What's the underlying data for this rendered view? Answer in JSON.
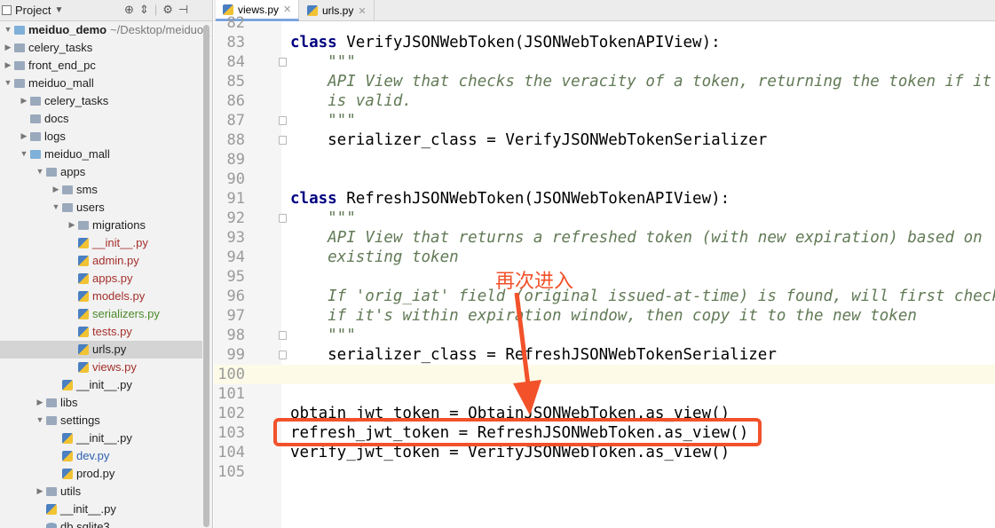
{
  "project_panel": {
    "title": "Project",
    "tree": [
      {
        "label": "meiduo_demo",
        "suffix": "~/Desktop/meiduo_",
        "indent": 0,
        "type": "folder-blue",
        "arrow": "down",
        "style": "bold"
      },
      {
        "label": "celery_tasks",
        "indent": 0,
        "type": "folder",
        "arrow": "right"
      },
      {
        "label": "front_end_pc",
        "indent": 0,
        "type": "folder",
        "arrow": "right"
      },
      {
        "label": "meiduo_mall",
        "indent": 0,
        "type": "folder",
        "arrow": "down"
      },
      {
        "label": "celery_tasks",
        "indent": 1,
        "type": "folder",
        "arrow": "right"
      },
      {
        "label": "docs",
        "indent": 1,
        "type": "folder",
        "arrow": "none"
      },
      {
        "label": "logs",
        "indent": 1,
        "type": "folder",
        "arrow": "right"
      },
      {
        "label": "meiduo_mall",
        "indent": 1,
        "type": "folder-blue",
        "arrow": "down"
      },
      {
        "label": "apps",
        "indent": 2,
        "type": "folder",
        "arrow": "down"
      },
      {
        "label": "sms",
        "indent": 3,
        "type": "folder",
        "arrow": "right"
      },
      {
        "label": "users",
        "indent": 3,
        "type": "folder",
        "arrow": "down"
      },
      {
        "label": "migrations",
        "indent": 4,
        "type": "folder",
        "arrow": "right"
      },
      {
        "label": "__init__.py",
        "indent": 4,
        "type": "py",
        "arrow": "none",
        "color": "red"
      },
      {
        "label": "admin.py",
        "indent": 4,
        "type": "py",
        "arrow": "none",
        "color": "red"
      },
      {
        "label": "apps.py",
        "indent": 4,
        "type": "py",
        "arrow": "none",
        "color": "red"
      },
      {
        "label": "models.py",
        "indent": 4,
        "type": "py",
        "arrow": "none",
        "color": "red"
      },
      {
        "label": "serializers.py",
        "indent": 4,
        "type": "py",
        "arrow": "none",
        "color": "green"
      },
      {
        "label": "tests.py",
        "indent": 4,
        "type": "py",
        "arrow": "none",
        "color": "red"
      },
      {
        "label": "urls.py",
        "indent": 4,
        "type": "py",
        "arrow": "none",
        "selected": true
      },
      {
        "label": "views.py",
        "indent": 4,
        "type": "py",
        "arrow": "none",
        "color": "red"
      },
      {
        "label": "__init__.py",
        "indent": 3,
        "type": "py",
        "arrow": "none"
      },
      {
        "label": "libs",
        "indent": 2,
        "type": "folder",
        "arrow": "right"
      },
      {
        "label": "settings",
        "indent": 2,
        "type": "folder",
        "arrow": "down"
      },
      {
        "label": "__init__.py",
        "indent": 3,
        "type": "py",
        "arrow": "none"
      },
      {
        "label": "dev.py",
        "indent": 3,
        "type": "py",
        "arrow": "none",
        "color": "blue"
      },
      {
        "label": "prod.py",
        "indent": 3,
        "type": "py",
        "arrow": "none"
      },
      {
        "label": "utils",
        "indent": 2,
        "type": "folder",
        "arrow": "right"
      },
      {
        "label": "__init__.py",
        "indent": 2,
        "type": "py",
        "arrow": "none"
      },
      {
        "label": "db.sqlite3",
        "indent": 2,
        "type": "db",
        "arrow": "none"
      }
    ]
  },
  "tabs": [
    {
      "label": "views.py",
      "active": true
    },
    {
      "label": "urls.py",
      "active": false
    }
  ],
  "editor": {
    "highlight_line": "100",
    "lines": [
      {
        "n": "82",
        "text": ""
      },
      {
        "n": "83",
        "kw": "class",
        "text": " VerifyJSONWebToken(JSONWebTokenAPIView):",
        "fold": false
      },
      {
        "n": "84",
        "doc": "    \"\"\"",
        "fold": true
      },
      {
        "n": "85",
        "doc": "    API View that checks the veracity of a token, returning the token if it"
      },
      {
        "n": "86",
        "doc": "    is valid."
      },
      {
        "n": "87",
        "doc": "    \"\"\"",
        "fold": true
      },
      {
        "n": "88",
        "text": "    serializer_class = VerifyJSONWebTokenSerializer",
        "fold": true
      },
      {
        "n": "89",
        "text": ""
      },
      {
        "n": "90",
        "text": ""
      },
      {
        "n": "91",
        "kw": "class",
        "text": " RefreshJSONWebToken(JSONWebTokenAPIView):",
        "fold": false
      },
      {
        "n": "92",
        "doc": "    \"\"\"",
        "fold": true
      },
      {
        "n": "93",
        "doc": "    API View that returns a refreshed token (with new expiration) based on"
      },
      {
        "n": "94",
        "doc": "    existing token"
      },
      {
        "n": "95",
        "text": ""
      },
      {
        "n": "96",
        "doc": "    If 'orig_iat' field (original issued-at-time) is found, will first check"
      },
      {
        "n": "97",
        "doc": "    if it's within expiration window, then copy it to the new token"
      },
      {
        "n": "98",
        "doc": "    \"\"\"",
        "fold": true
      },
      {
        "n": "99",
        "text": "    serializer_class = RefreshJSONWebTokenSerializer",
        "fold": true
      },
      {
        "n": "100",
        "text": ""
      },
      {
        "n": "101",
        "text": ""
      },
      {
        "n": "102",
        "text": "obtain_jwt_token = ObtainJSONWebToken.as_view()"
      },
      {
        "n": "103",
        "text": "refresh_jwt_token = RefreshJSONWebToken.as_view()"
      },
      {
        "n": "104",
        "text": "verify_jwt_token = VerifyJSONWebToken.as_view()"
      },
      {
        "n": "105",
        "text": ""
      }
    ]
  },
  "annotation": {
    "text": "再次进入",
    "color": "#f2512a",
    "target_line": "102"
  }
}
